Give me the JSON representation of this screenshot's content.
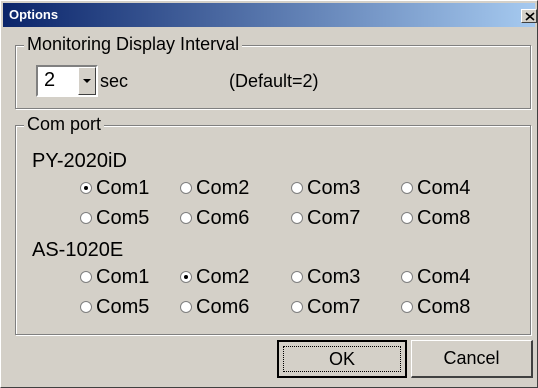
{
  "window": {
    "title": "Options",
    "close_icon": "close-icon"
  },
  "interval_group": {
    "label": "Monitoring Display Interval",
    "combo_value": "2",
    "unit": "sec",
    "default_note": "(Default=2)"
  },
  "com_group": {
    "label": "Com port",
    "devices": [
      {
        "name": "PY-2020iD",
        "options": [
          "Com1",
          "Com2",
          "Com3",
          "Com4",
          "Com5",
          "Com6",
          "Com7",
          "Com8"
        ],
        "selected": "Com1"
      },
      {
        "name": "AS-1020E",
        "options": [
          "Com1",
          "Com2",
          "Com3",
          "Com4",
          "Com5",
          "Com6",
          "Com7",
          "Com8"
        ],
        "selected": "Com2"
      }
    ]
  },
  "buttons": {
    "ok": "OK",
    "cancel": "Cancel"
  }
}
